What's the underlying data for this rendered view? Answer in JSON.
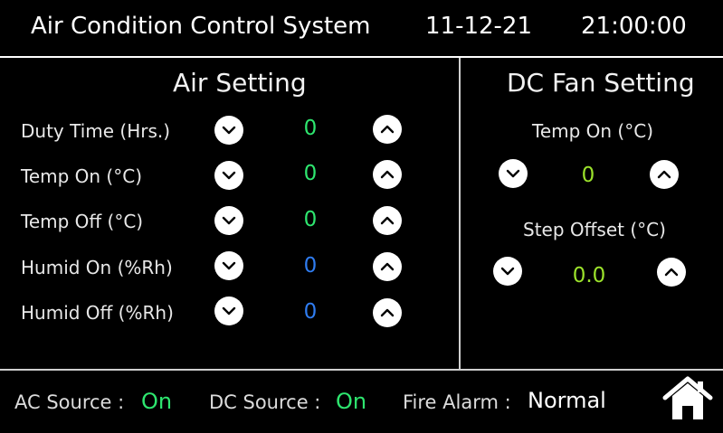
{
  "header": {
    "title": "Air Condition Control System",
    "date": "11-12-21",
    "time": "21:00:00"
  },
  "air_setting": {
    "title": "Air Setting",
    "rows": [
      {
        "label": "Duty Time (Hrs.)",
        "value": "0"
      },
      {
        "label": "Temp On (°C)",
        "value": "0"
      },
      {
        "label": "Temp Off (°C)",
        "value": "0"
      },
      {
        "label": "Humid On (%Rh)",
        "value": "0"
      },
      {
        "label": "Humid Off (%Rh)",
        "value": "0"
      }
    ]
  },
  "dc_fan_setting": {
    "title": "DC Fan Setting",
    "rows": [
      {
        "label": "Temp On (°C)",
        "value": "0"
      },
      {
        "label": "Step Offset (°C)",
        "value": "0.0"
      }
    ]
  },
  "status": {
    "ac_source_label": "AC Source :",
    "ac_source_value": "On",
    "dc_source_label": "DC Source :",
    "dc_source_value": "On",
    "fire_alarm_label": "Fire Alarm :",
    "fire_alarm_value": "Normal"
  },
  "colors": {
    "temp_value": "#2ee66f",
    "humid_value": "#2f7cf0",
    "fan_value": "#9be22b",
    "on_value": "#2ee66f"
  },
  "icons": {
    "decrease": "chevron-down-icon",
    "increase": "chevron-up-icon",
    "home": "home-icon"
  }
}
